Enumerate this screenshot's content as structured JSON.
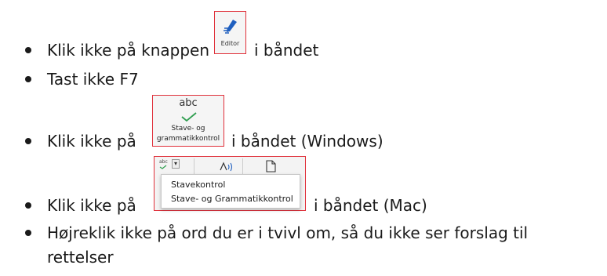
{
  "items": [
    {
      "before": "Klik ikke på knappen",
      "after": "i båndet",
      "button": {
        "label": "Editor",
        "icon": "editor-pen-icon"
      }
    },
    {
      "text": "Tast ikke F7"
    },
    {
      "before": "Klik ikke på",
      "after": "i båndet (Windows)",
      "button": {
        "top_text": "abc",
        "line1": "Stave- og",
        "line2": "grammatikkontrol",
        "icon": "checkmark-icon"
      }
    },
    {
      "before": "Klik ikke på",
      "after": "i båndet (Mac)",
      "mac_menu": {
        "mini_label": "abc",
        "menu_items": [
          "Stavekontrol",
          "Stave- og Grammatikkontrol"
        ]
      }
    },
    {
      "line1": "Højreklik ikke på ord du er i tvivl om, så du ikke ser forslag til",
      "line2": "rettelser"
    }
  ],
  "colors": {
    "highlight_border": "#e0303a",
    "editor_icon": "#1f5fbf",
    "check": "#2e9e4f"
  }
}
